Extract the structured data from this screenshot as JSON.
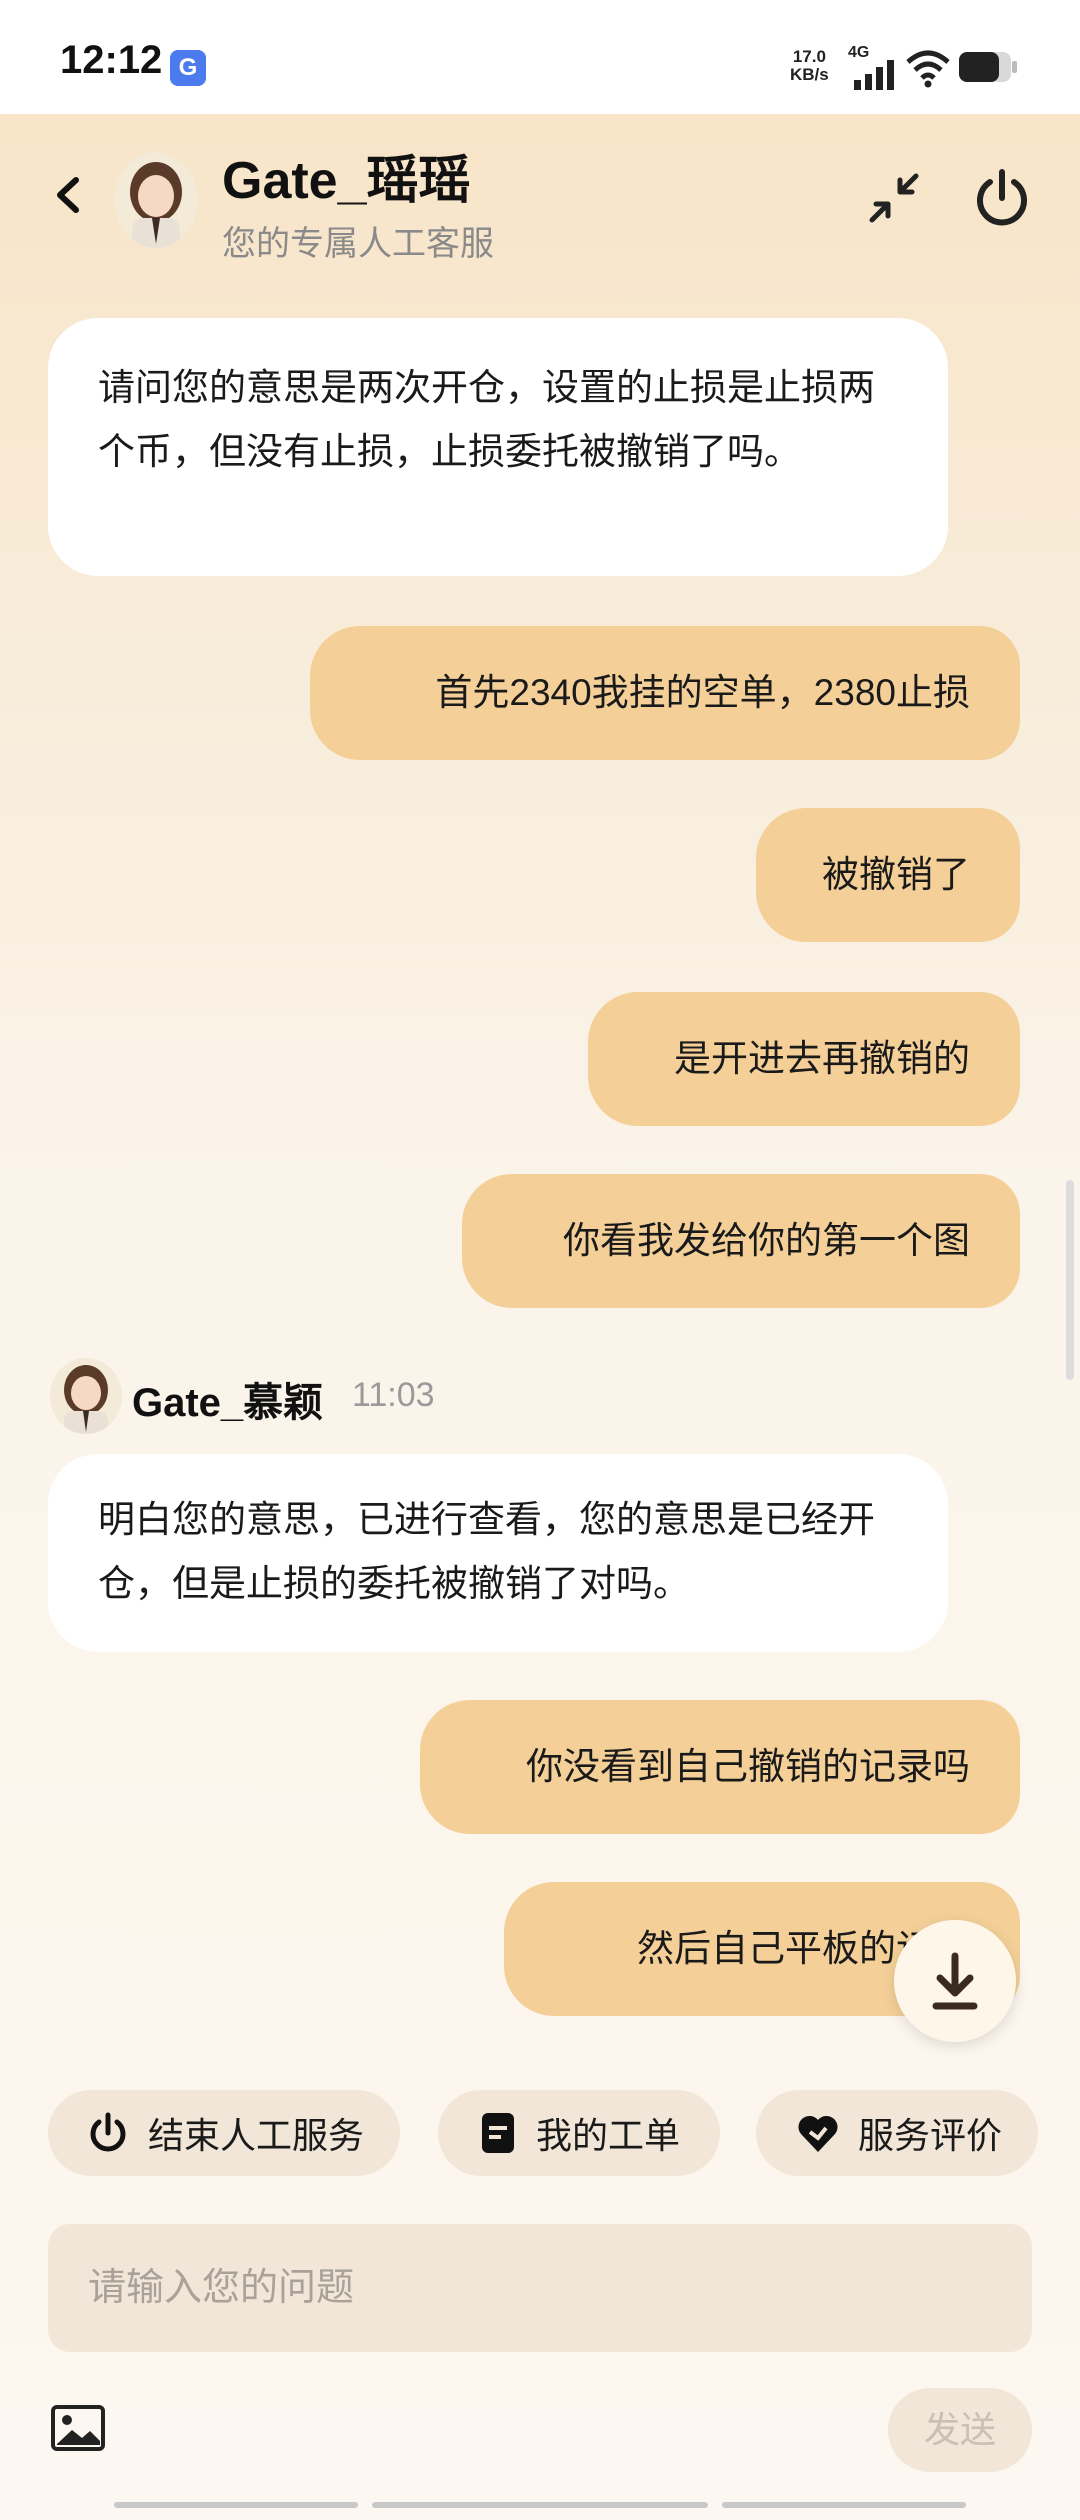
{
  "status_bar": {
    "time": "12:12",
    "app_badge": "G",
    "net_speed_value": "17.0",
    "net_speed_unit": "KB/s",
    "network_type": "4G"
  },
  "header": {
    "title": "Gate_瑶瑶",
    "subtitle": "您的专属人工客服"
  },
  "messages": [
    {
      "role": "agent",
      "text": "请问您的意思是两次开仓，设置的止损是止损两个币，但没有止损，止损委托被撤销了吗。"
    },
    {
      "role": "user",
      "text": "首先2340我挂的空单，2380止损"
    },
    {
      "role": "user",
      "text": "被撤销了"
    },
    {
      "role": "user",
      "text": "是开进去再撤销的"
    },
    {
      "role": "user",
      "text": "你看我发给你的第一个图"
    },
    {
      "role": "agent",
      "text": "明白您的意思，已进行查看，您的意思是已经开仓，但是止损的委托被撤销了对吗。"
    },
    {
      "role": "user",
      "text": "你没看到自己撤销的记录吗"
    },
    {
      "role": "user",
      "text": "然后自己平板的记录"
    }
  ],
  "agent_name_2": "Gate_慕颖",
  "agent_time_2": "11:03",
  "quick_actions": [
    {
      "label": "结束人工服务",
      "icon": "power-icon"
    },
    {
      "label": "我的工单",
      "icon": "document-icon"
    },
    {
      "label": "服务评价",
      "icon": "heart-icon"
    }
  ],
  "composer": {
    "placeholder": "请输入您的问题",
    "send_label": "发送"
  },
  "colors": {
    "user_bubble": "#f4d098",
    "agent_bubble": "#ffffff",
    "chip_bg": "#f1e6d7"
  }
}
